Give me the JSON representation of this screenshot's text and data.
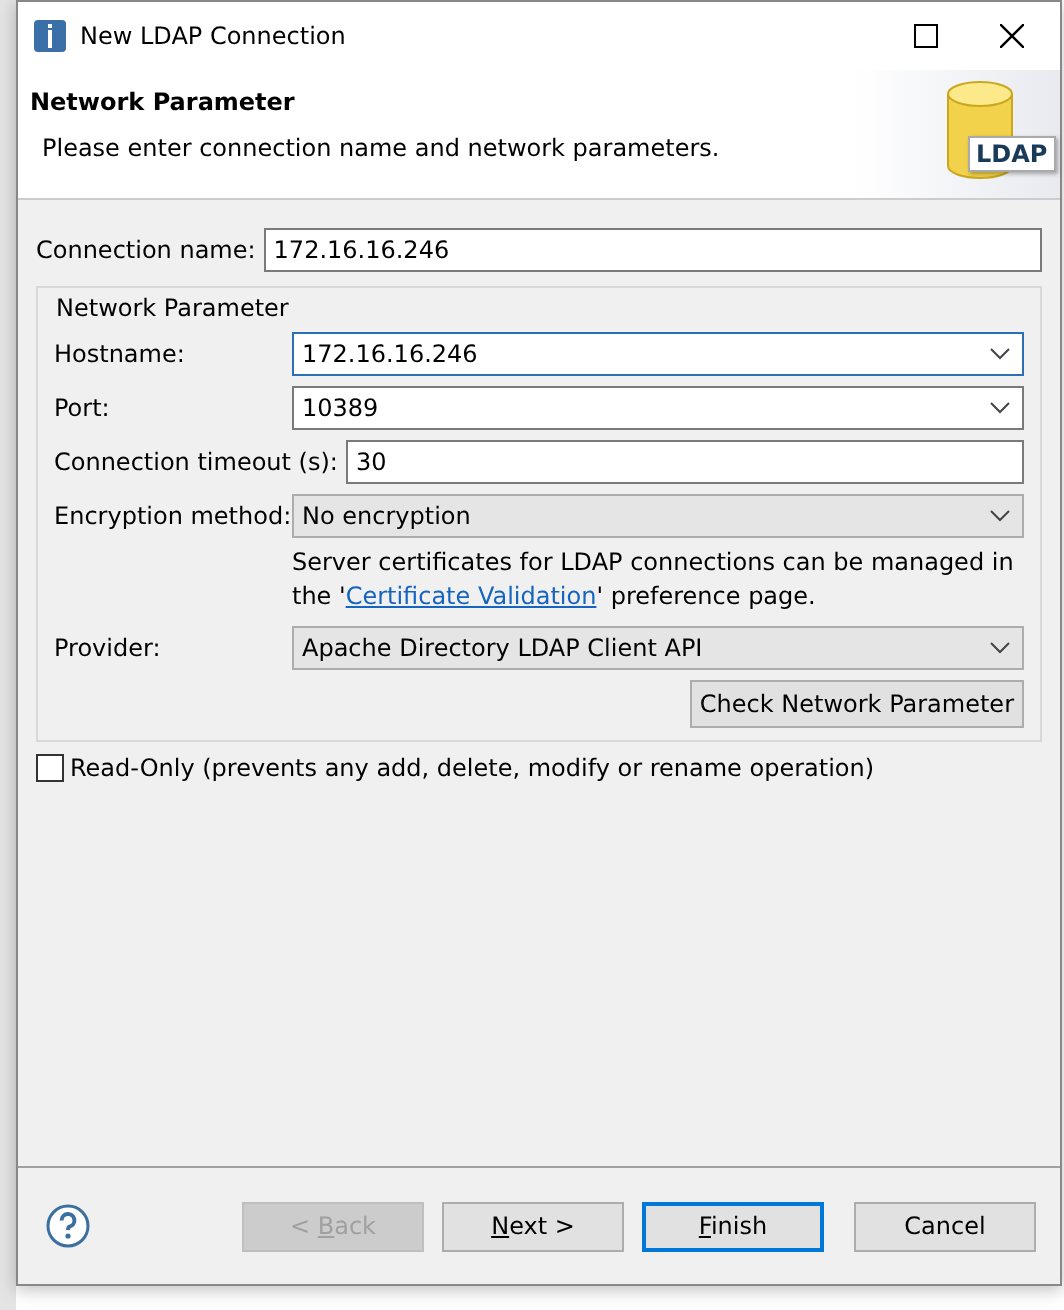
{
  "window": {
    "title": "New LDAP Connection"
  },
  "header": {
    "title": "Network Parameter",
    "description": "Please enter connection name and network parameters.",
    "logo_text": "LDAP"
  },
  "connection_name": {
    "label": "Connection name:",
    "value": "172.16.16.246"
  },
  "group": {
    "title": "Network Parameter",
    "fields": [
      {
        "kind": "combo",
        "label": "Hostname:",
        "value": "172.16.16.246",
        "focused": true
      },
      {
        "kind": "combo",
        "label": "Port:",
        "value": "10389",
        "focused": false
      },
      {
        "kind": "text",
        "label": "Connection timeout (s):",
        "value": "30",
        "focused": false
      },
      {
        "kind": "select",
        "label": "Encryption method:",
        "value": "No encryption",
        "focused": false
      },
      {
        "kind": "note",
        "pre": "Server certificates for LDAP connections can be managed in the '",
        "link": "Certificate Validation",
        "post": "' preference page."
      },
      {
        "kind": "select",
        "label": "Provider:",
        "value": "Apache Directory LDAP Client API",
        "focused": false
      }
    ],
    "check_button": "Check Network Parameter"
  },
  "read_only": {
    "label": "Read-Only (prevents any add, delete, modify or rename operation)",
    "checked": false
  },
  "buttons": [
    {
      "pre": "< ",
      "key": "B",
      "post": "ack",
      "disabled": true,
      "default": false
    },
    {
      "key": "N",
      "post": "ext >",
      "disabled": false,
      "default": false
    },
    {
      "key": "F",
      "post": "inish",
      "disabled": false,
      "default": true
    },
    {
      "pre": "Cancel",
      "disabled": false,
      "default": false
    }
  ]
}
